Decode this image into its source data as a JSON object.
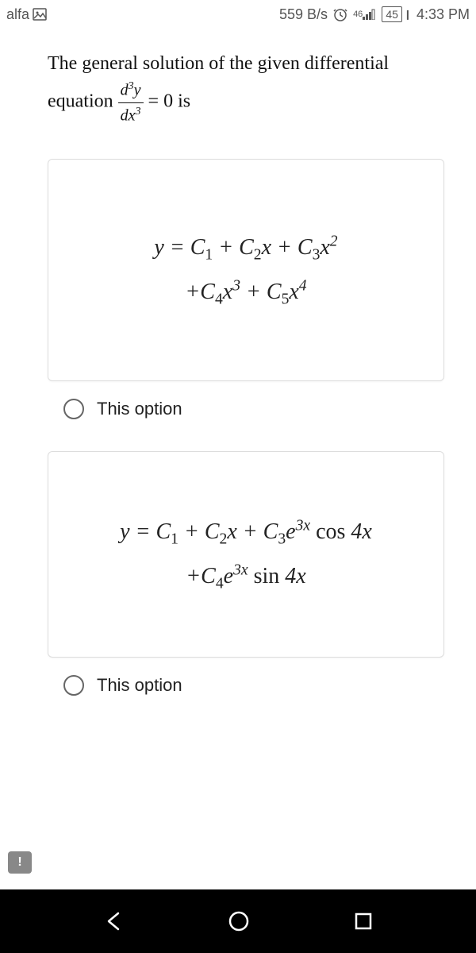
{
  "status": {
    "carrier": "alfa",
    "speed": "559 B/s",
    "signal_label": "46",
    "battery": "45",
    "time": "4:33 PM"
  },
  "question": {
    "line1_a": "The general solution of the given differential",
    "line2_a": "equation",
    "frac_num_html": "d<sup style='font-size:0.7em'>3</sup>y",
    "frac_den_html": "dx<sup style='font-size:0.7em'>3</sup>",
    "line2_b": " = 0 is"
  },
  "options": [
    {
      "math_line1": "y = C<span class='sub'>1</span> + C<span class='sub'>2</span>x + C<span class='sub'>3</span>x<span class='sup'>2</span>",
      "math_line2": "+C<span class='sub'>4</span>x<span class='sup'>3</span> + C<span class='sub'>5</span>x<span class='sup'>4</span>",
      "label": "This option"
    },
    {
      "math_line1": "y = C<span class='sub'>1</span> + C<span class='sub'>2</span>x + C<span class='sub'>3</span>e<span class='sup'>3x</span> <span class='rm'>cos</span> 4x",
      "math_line2": "+C<span class='sub'>4</span>e<span class='sup'>3x</span> <span class='rm'>sin</span> 4x",
      "label": "This option"
    }
  ],
  "chat_badge": "!",
  "icons": {
    "image": "image-icon",
    "alarm": "alarm-icon",
    "signal": "signal-icon"
  }
}
